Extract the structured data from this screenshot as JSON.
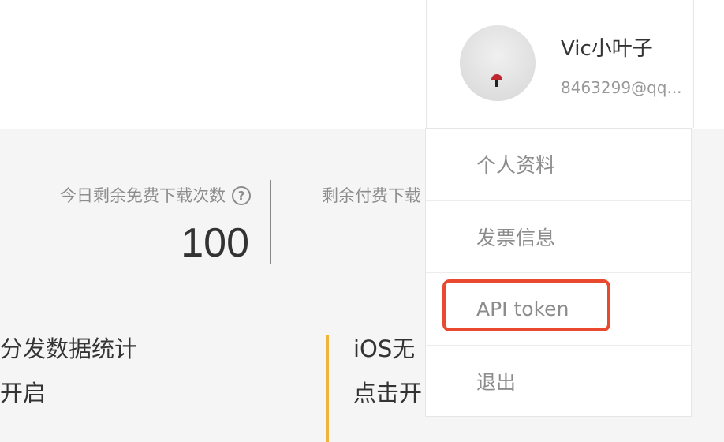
{
  "stats": {
    "free_label": "今日剩余免费下载次数",
    "free_value": "100",
    "paid_label": "剩余付费下载"
  },
  "cards": [
    {
      "title": "分发数据统计",
      "action": "开启"
    },
    {
      "title": "iOS无",
      "action": "点击开"
    }
  ],
  "user": {
    "name": "Vic小叶子",
    "email": "8463299@qq..."
  },
  "menu": [
    {
      "label": "个人资料"
    },
    {
      "label": "发票信息"
    },
    {
      "label": "API token"
    },
    {
      "label": "退出"
    }
  ],
  "annotation": {
    "color": "#e8492f",
    "highlighted_item": "API token"
  },
  "colors": {
    "accent": "#f0b43c",
    "text_muted": "#8c8c8c",
    "text_main": "#333333"
  }
}
